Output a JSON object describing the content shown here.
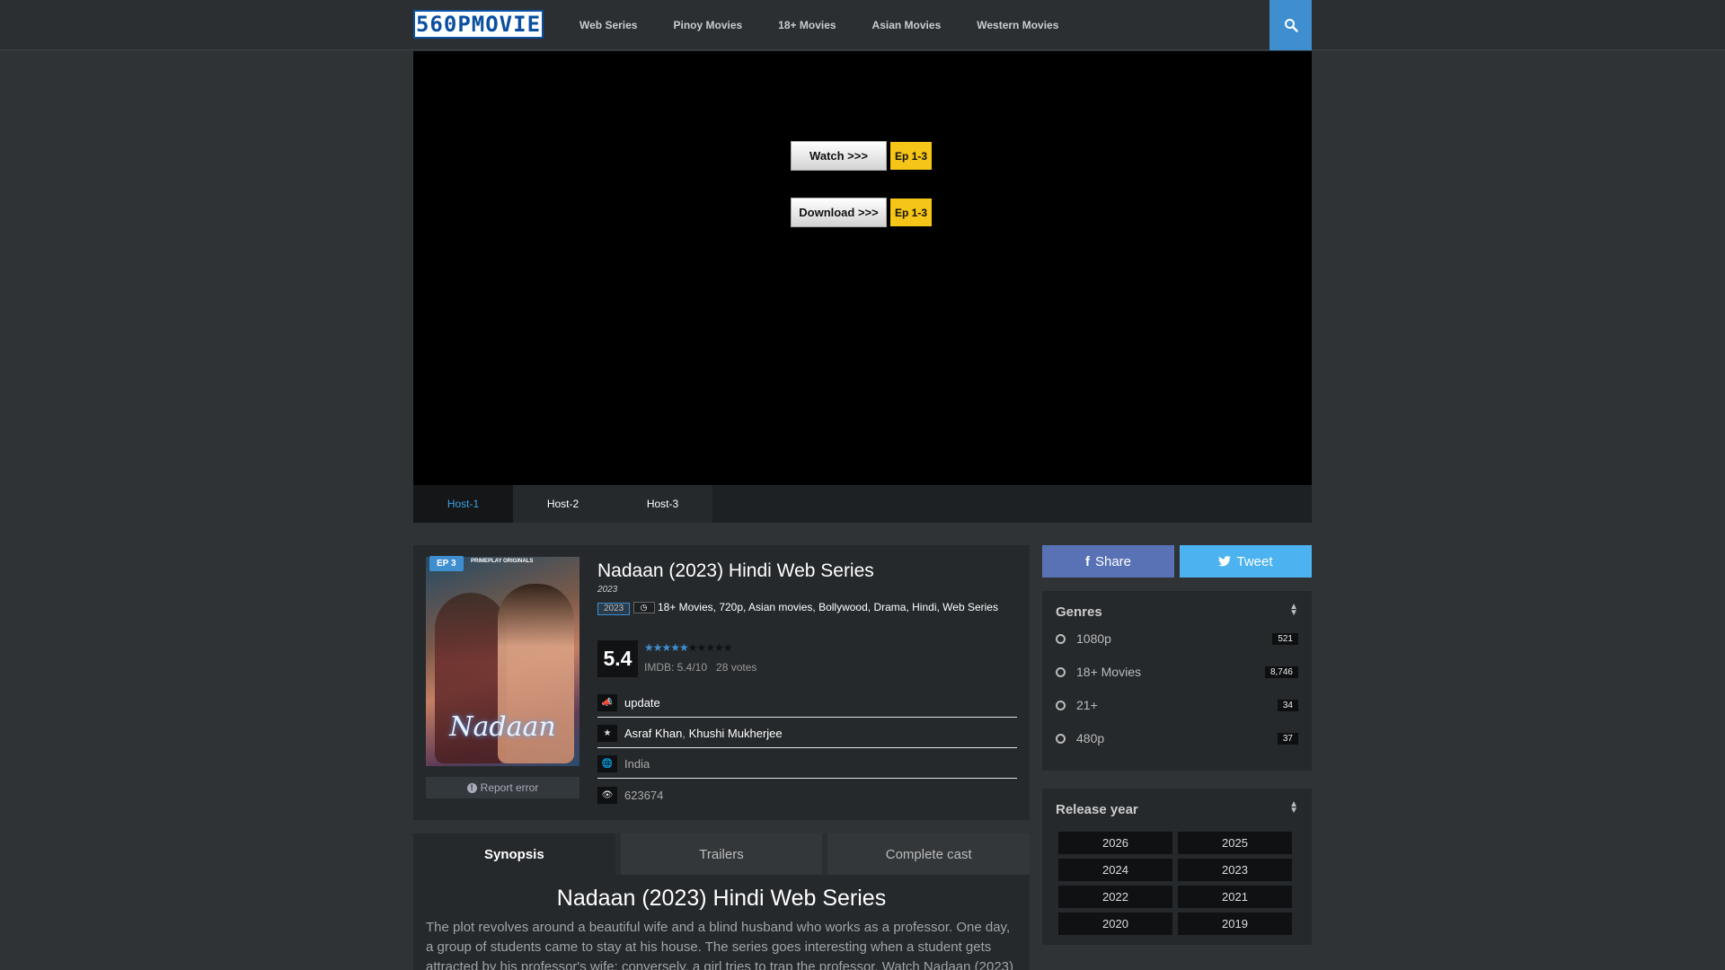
{
  "header": {
    "logo_text": "560PMOVIE",
    "nav": [
      "Web Series",
      "Pinoy Movies",
      "18+ Movies",
      "Asian Movies",
      "Western Movies"
    ]
  },
  "player": {
    "watch_label": "Watch >>>",
    "watch_ep": "Ep 1-3",
    "download_label": "Download >>>",
    "download_ep": "Ep 1-3",
    "hosts": [
      "Host-1",
      "Host-2",
      "Host-3"
    ],
    "active_host": "Host-1"
  },
  "movie": {
    "episode_badge": "EP 3",
    "poster_title": "Nadaan",
    "poster_brand": "PRIMEPLAY ORIGINALS",
    "title": "Nadaan (2023) Hindi Web Series",
    "year": "2023",
    "year_tag": "2023",
    "tags": [
      "18+ Movies",
      "720p",
      "Asian movies",
      "Bollywood",
      "Drama",
      "Hindi",
      "Web Series"
    ],
    "rating": "5.4",
    "stars_filled": 5.4,
    "stars_total": 10,
    "imdb_text": "IMDB: 5.4/10",
    "votes_text": "28 votes",
    "status": "update",
    "cast": [
      "Asraf Khan",
      "Khushi Mukherjee"
    ],
    "country": "India",
    "views": "623674",
    "report_label": "Report error"
  },
  "tabs": [
    "Synopsis",
    "Trailers",
    "Complete cast"
  ],
  "synopsis": {
    "title": "Nadaan (2023) Hindi Web Series",
    "text": "The plot revolves around a beautiful wife and a blind husband who works as a professor. One day, a group of students came to stay at his house. The series goes interesting when a student gets attracted by his professor's wife; conversely, a girl tries to trap the professor. Watch Nadaan (2023)"
  },
  "sidebar": {
    "share_label": "Share",
    "tweet_label": "Tweet",
    "genres_title": "Genres",
    "genres": [
      {
        "name": "1080p",
        "count": "521"
      },
      {
        "name": "18+ Movies",
        "count": "8,746"
      },
      {
        "name": "21+",
        "count": "34"
      },
      {
        "name": "480p",
        "count": "37"
      }
    ],
    "release_title": "Release year",
    "years": [
      "2026",
      "2025",
      "2024",
      "2023",
      "2022",
      "2021",
      "2020",
      "2019"
    ]
  },
  "colors": {
    "accent": "#3e8ed0",
    "episode_badge": "#f5c518",
    "share": "#5972b6",
    "tweet": "#4cb3f0"
  }
}
